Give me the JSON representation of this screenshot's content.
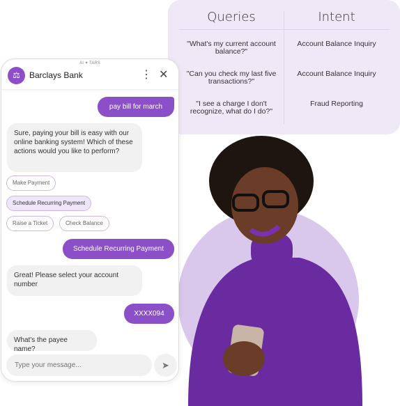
{
  "table": {
    "headers": [
      "Queries",
      "Intent"
    ],
    "rows": [
      {
        "query": "\"What's my current account balance?\"",
        "intent": "Account Balance Inquiry"
      },
      {
        "query": "\"Can you check my last five transactions?\"",
        "intent": "Account Balance Inquiry"
      },
      {
        "query": "\"I see a charge I don't recognize, what do I do?\"",
        "intent": "Fraud Reporting"
      }
    ]
  },
  "chat": {
    "brand": "AI ✦ TARS",
    "title": "Barclays Bank",
    "avatar_icon": "scales-icon",
    "messages": [
      {
        "from": "user",
        "text": "pay bill for march"
      },
      {
        "from": "bot",
        "text": "Sure, paying your bill is easy with our online banking system! Which of these actions would you like to perform?"
      },
      {
        "from": "user",
        "text": "Schedule Recurring Payment"
      },
      {
        "from": "bot",
        "text": "Great! Please select your account number"
      },
      {
        "from": "user",
        "text": "XXXX094"
      },
      {
        "from": "bot",
        "text": "What's the payee name?"
      }
    ],
    "options": [
      "Make Payment",
      "Schedule Recurring Payment",
      "Raise a Ticket",
      "Check Balance"
    ],
    "selected_option": "Schedule Recurring Payment",
    "input_placeholder": "Type your message..."
  },
  "colors": {
    "accent": "#8b50c8",
    "panel": "#efe8f7"
  }
}
